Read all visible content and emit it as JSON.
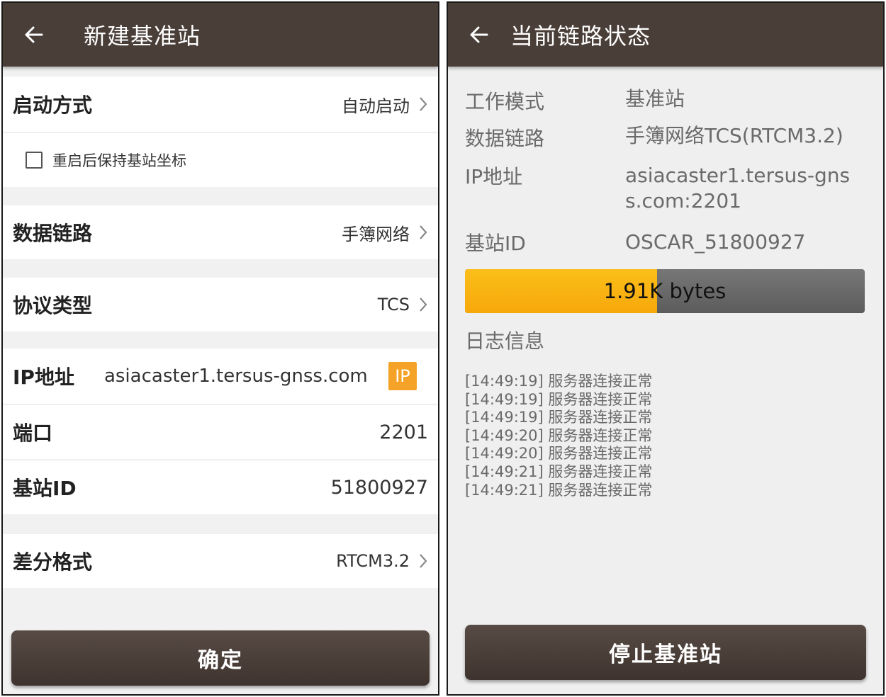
{
  "left": {
    "title": "新建基准站",
    "startup": {
      "label": "启动方式",
      "value": "自动启动"
    },
    "keep_coords": {
      "label": "重启后保持基站坐标",
      "checked": false
    },
    "data_link": {
      "label": "数据链路",
      "value": "手簿网络"
    },
    "protocol": {
      "label": "协议类型",
      "value": "TCS"
    },
    "ip": {
      "label": "IP地址",
      "value": "asiacaster1.tersus-gnss.com",
      "badge": "IP"
    },
    "port": {
      "label": "端口",
      "value": "2201"
    },
    "base_id": {
      "label": "基站ID",
      "value": "51800927"
    },
    "diff_format": {
      "label": "差分格式",
      "value": "RTCM3.2"
    },
    "confirm_label": "确定"
  },
  "right": {
    "title": "当前链路状态",
    "info": [
      {
        "label": "工作模式",
        "value": "基准站"
      },
      {
        "label": "数据链路",
        "value": "手簿网络TCS(RTCM3.2)"
      },
      {
        "label": "IP地址",
        "value": "asiacaster1.tersus-gnss.com:2201"
      },
      {
        "label": "基站ID",
        "value": "OSCAR_51800927"
      }
    ],
    "progress": {
      "text": "1.91K bytes",
      "fraction": 0.48
    },
    "log_title": "日志信息",
    "logs": [
      "[14:49:19] 服务器连接正常",
      "[14:49:19] 服务器连接正常",
      "[14:49:19] 服务器连接正常",
      "[14:49:20] 服务器连接正常",
      "[14:49:20] 服务器连接正常",
      "[14:49:21] 服务器连接正常",
      "[14:49:21] 服务器连接正常"
    ],
    "stop_label": "停止基准站"
  },
  "colors": {
    "appbar": "#4a3e38",
    "progress_fill": "#f7a80a",
    "ip_badge": "#f5a328"
  },
  "icons": {
    "back": "arrow-left-icon",
    "chevron": "chevron-right-icon",
    "checkbox": "checkbox-unchecked-icon"
  }
}
